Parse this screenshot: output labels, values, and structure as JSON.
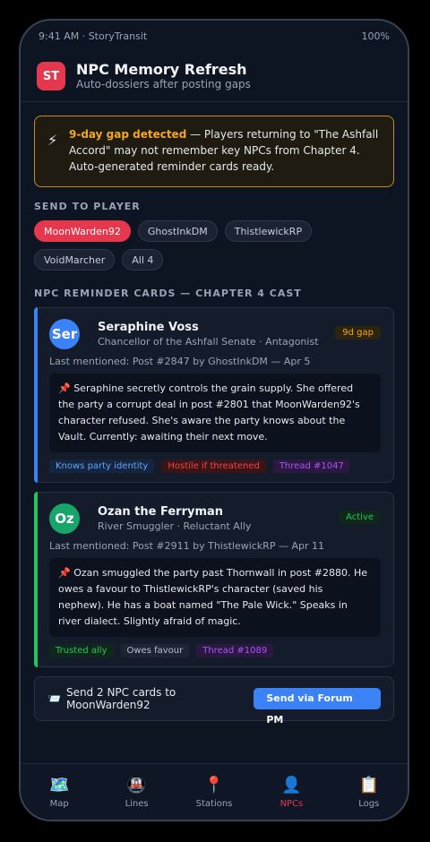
{
  "status": {
    "left": "9:41 AM · StoryTransit",
    "right": "100%"
  },
  "app": {
    "logo": "ST",
    "title": "NPC Memory Refresh",
    "subtitle": "Auto-dossiers after posting gaps"
  },
  "alert": {
    "icon": "⚡",
    "highlight": "9-day gap detected",
    "text": " — Players returning to \"The Ashfall Accord\" may not remember key NPCs from Chapter 4. Auto-generated reminder cards ready."
  },
  "send_section": {
    "label": "SEND TO PLAYER",
    "players": [
      "MoonWarden92",
      "GhostInkDM",
      "ThistlewickRP",
      "VoidMarcher",
      "All 4"
    ],
    "selected_index": 0
  },
  "cards_section": {
    "label": "NPC REMINDER CARDS — CHAPTER 4 CAST"
  },
  "cards": [
    {
      "avatar": "Ser",
      "name": "Seraphine Voss",
      "role": "Chancellor of the Ashfall Senate · Antagonist",
      "badge": "9d gap",
      "last": "Last mentioned: Post #2847 by GhostInkDM — Apr 5",
      "note": "📌 Seraphine secretly controls the grain supply. She offered the party a corrupt deal in post #2801 that MoonWarden92's character refused. She's aware the party knows about the Vault. Currently: awaiting their next move.",
      "tags": [
        "Knows party identity",
        "Hostile if threatened",
        "Thread #1047"
      ],
      "colors": {
        "accent": "#3b82f6",
        "avatar": "#3b82f6",
        "badge_bg": "#2d2410",
        "badge_fg": "#f5a623"
      }
    },
    {
      "avatar": "Oz",
      "name": "Ozan the Ferryman",
      "role": "River Smuggler · Reluctant Ally",
      "badge": "Active",
      "last": "Last mentioned: Post #2911 by ThistlewickRP — Apr 11",
      "note": "📌 Ozan smuggled the party past Thornwall in post #2880. He owes a favour to ThistlewickRP's character (saved his nephew). He has a boat named \"The Pale Wick.\" Speaks in river dialect. Slightly afraid of magic.",
      "tags": [
        "Trusted ally",
        "Owes favour",
        "Thread #1089"
      ],
      "colors": {
        "accent": "#22c55e",
        "avatar": "#16a66a",
        "badge_bg": "#10281c",
        "badge_fg": "#22c55e"
      }
    }
  ],
  "sendbar": {
    "icon": "📨",
    "text": "Send 2 NPC cards to MoonWarden92",
    "button": "Send via Forum PM"
  },
  "tabs": [
    {
      "icon": "🗺️",
      "label": "Map"
    },
    {
      "icon": "🚇",
      "label": "Lines"
    },
    {
      "icon": "📍",
      "label": "Stations"
    },
    {
      "icon": "👤",
      "label": "NPCs"
    },
    {
      "icon": "📋",
      "label": "Logs"
    }
  ],
  "active_tab": 3
}
